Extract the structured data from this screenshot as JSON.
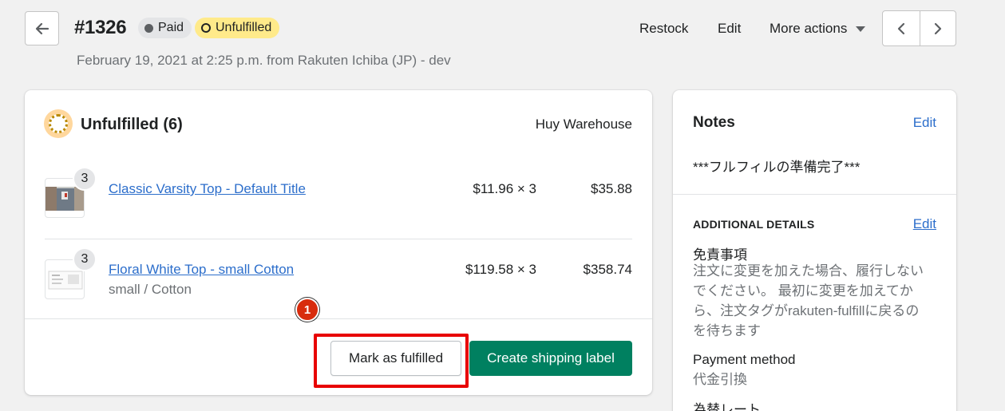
{
  "header": {
    "order_number": "#1326",
    "badges": {
      "paid": "Paid",
      "unfulfilled": "Unfulfilled"
    },
    "subtitle": "February 19, 2021 at 2:25 p.m. from Rakuten Ichiba (JP) - dev",
    "actions": {
      "restock": "Restock",
      "edit": "Edit",
      "more": "More actions"
    }
  },
  "fulfillment": {
    "title": "Unfulfilled (6)",
    "location": "Huy Warehouse",
    "items": [
      {
        "qty": "3",
        "name": "Classic Varsity Top - Default Title",
        "variant": "",
        "price": "$11.96 × 3",
        "total": "$35.88"
      },
      {
        "qty": "3",
        "name": "Floral White Top - small Cotton",
        "variant": "small / Cotton",
        "price": "$119.58 × 3",
        "total": "$358.74"
      }
    ],
    "step_marker": "1",
    "buttons": {
      "mark_fulfilled": "Mark as fulfilled",
      "create_label": "Create shipping label"
    }
  },
  "notes": {
    "title": "Notes",
    "edit": "Edit",
    "text": "***フルフィルの準備完了***",
    "additional": {
      "title": "ADDITIONAL DETAILS",
      "edit": "Edit",
      "details": [
        {
          "label": "免責事項",
          "value": "注文に変更を加えた場合、履行しないでください。 最初に変更を加えてから、注文タグがrakuten-fulfillに戻るのを待ちます"
        },
        {
          "label": "Payment method",
          "value": "代金引換"
        },
        {
          "label": "為替レート",
          "value": ""
        }
      ]
    }
  },
  "colors": {
    "primary": "#008060",
    "link": "#2c6ecb",
    "highlight": "#e80000",
    "attention": "#ffea8a"
  }
}
